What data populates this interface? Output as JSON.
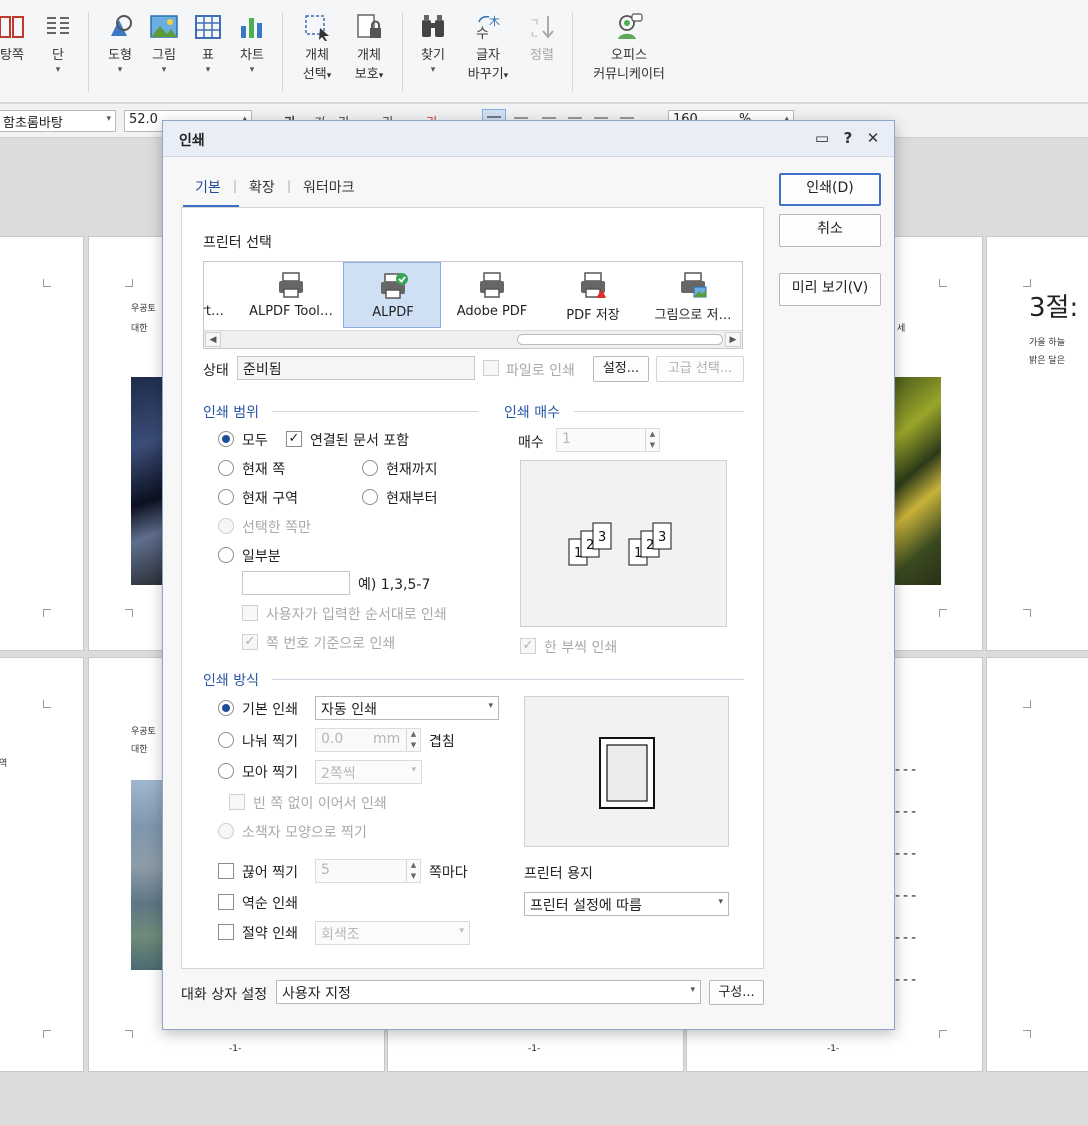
{
  "ribbon": {
    "items": [
      {
        "label": "탕쪽",
        "label2": ""
      },
      {
        "label": "단",
        "label2": ""
      },
      {
        "label": "도형",
        "label2": ""
      },
      {
        "label": "그림",
        "label2": ""
      },
      {
        "label": "표",
        "label2": ""
      },
      {
        "label": "차트",
        "label2": ""
      },
      {
        "label": "개체",
        "label2": "선택"
      },
      {
        "label": "개체",
        "label2": "보호"
      },
      {
        "label": "찾기",
        "label2": ""
      },
      {
        "label": "글자",
        "label2": "바꾸기"
      },
      {
        "label": "정렬",
        "label2": ""
      },
      {
        "label": "오피스",
        "label2": "커뮤니케이터"
      }
    ]
  },
  "formatbar": {
    "font": "함초롬바탕",
    "size": "52.0",
    "zoom": "160",
    "zoom_unit": "%"
  },
  "document": {
    "page_heading": "3절:",
    "page_small_1": "우공토",
    "page_small_2": "대한",
    "page_small_3": "가을 하늘",
    "page_small_4": "밝은 달은",
    "page_small_5": "우공토",
    "page_small_6": "대한",
    "page_num": "-1-"
  },
  "dialog": {
    "title": "인쇄",
    "tabs": [
      "기본",
      "확장",
      "워터마크"
    ],
    "printer_section": "프린터 선택",
    "printers": [
      {
        "name": "ort…",
        "icon": "printer-icon"
      },
      {
        "name": "ALPDF Tool…",
        "icon": "printer-icon"
      },
      {
        "name": "ALPDF",
        "icon": "printer-check-icon",
        "selected": true
      },
      {
        "name": "Adobe PDF",
        "icon": "printer-icon"
      },
      {
        "name": "PDF 저장",
        "icon": "pdf-printer-icon"
      },
      {
        "name": "그림으로 저…",
        "icon": "image-printer-icon"
      }
    ],
    "status_label": "상태",
    "status_value": "준비됨",
    "print_to_file": "파일로 인쇄",
    "settings_button": "설정...",
    "advanced_button": "고급 선택...",
    "range": {
      "title": "인쇄 범위",
      "all": "모두",
      "linked": "연결된 문서 포함",
      "current_page": "현재 쪽",
      "until_current": "현재까지",
      "current_section": "현재 구역",
      "from_current": "현재부터",
      "selected_pages": "선택한 쪽만",
      "partial": "일부분",
      "partial_value": "",
      "example": "예) 1,3,5-7",
      "user_order": "사용자가 입력한 순서대로 인쇄",
      "page_number_order": "쪽 번호 기준으로 인쇄"
    },
    "copies": {
      "title": "인쇄 매수",
      "label": "매수",
      "value": "1",
      "collate": "한 부씩 인쇄"
    },
    "method": {
      "title": "인쇄 방식",
      "basic": "기본 인쇄",
      "basic_value": "자동 인쇄",
      "split": "나눠 찍기",
      "split_value": "0.0",
      "split_unit": "mm",
      "overlap": "겹침",
      "collect": "모아 찍기",
      "collect_value": "2쪽씩",
      "no_blank": "빈 쪽 없이 이어서 인쇄",
      "booklet": "소책자 모양으로 찍기",
      "cut": "끊어 찍기",
      "cut_value": "5",
      "per_pages": "쪽마다",
      "reverse": "역순 인쇄",
      "saving": "절약 인쇄",
      "saving_value": "회색조"
    },
    "paper": {
      "label": "프린터 용지",
      "value": "프린터 설정에 따름"
    },
    "dialog_settings_label": "대화 상자 설정",
    "dialog_settings_value": "사용자 지정",
    "configure_button": "구성...",
    "print_button": "인쇄(D)",
    "cancel_button": "취소",
    "preview_button": "미리 보기(V)",
    "copies_pages": [
      "1",
      "2",
      "3",
      "1",
      "2",
      "3"
    ]
  },
  "colors": {
    "accent": "#1f4e99",
    "section_title": "#2a56a6",
    "selection": "#cfe0f5"
  }
}
